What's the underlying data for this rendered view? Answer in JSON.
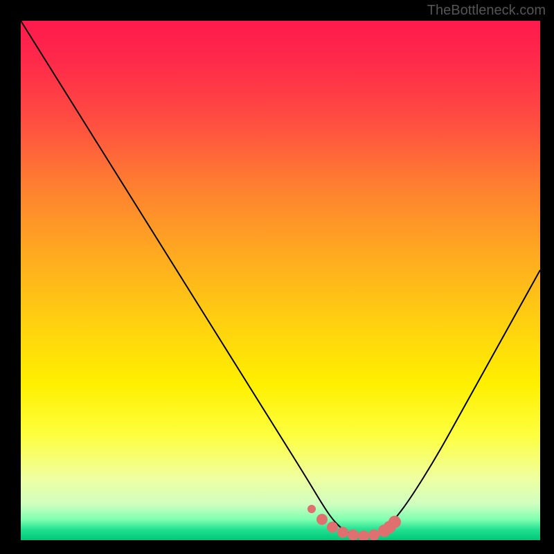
{
  "watermark": "TheBottleneck.com",
  "chart_data": {
    "type": "line",
    "title": "",
    "xlabel": "",
    "ylabel": "",
    "x_range": [
      0,
      100
    ],
    "y_range": [
      0,
      100
    ],
    "series": [
      {
        "name": "bottleneck-curve",
        "color": "#000000",
        "x": [
          0,
          5,
          10,
          15,
          20,
          25,
          30,
          35,
          40,
          45,
          50,
          55,
          58,
          60,
          62,
          64,
          66,
          68,
          70,
          72,
          75,
          80,
          85,
          90,
          95,
          100
        ],
        "y": [
          100,
          92,
          84,
          76,
          68,
          60,
          52,
          44,
          36,
          28,
          20,
          12,
          7,
          4,
          2,
          1,
          0.5,
          1,
          2,
          4,
          8,
          16,
          25,
          34,
          43,
          52
        ]
      }
    ],
    "highlight_points": {
      "name": "optimal-band",
      "color": "#e07070",
      "x": [
        56,
        58,
        60,
        62,
        64,
        66,
        68,
        70,
        71,
        72
      ],
      "y": [
        6,
        4,
        2.5,
        1.5,
        1,
        0.8,
        1,
        1.8,
        2.5,
        3.5
      ]
    },
    "gradient_stops": [
      {
        "pos": 0,
        "color": "#ff1a4d"
      },
      {
        "pos": 50,
        "color": "#ffd000"
      },
      {
        "pos": 80,
        "color": "#fdff40"
      },
      {
        "pos": 100,
        "color": "#00c878"
      }
    ]
  }
}
